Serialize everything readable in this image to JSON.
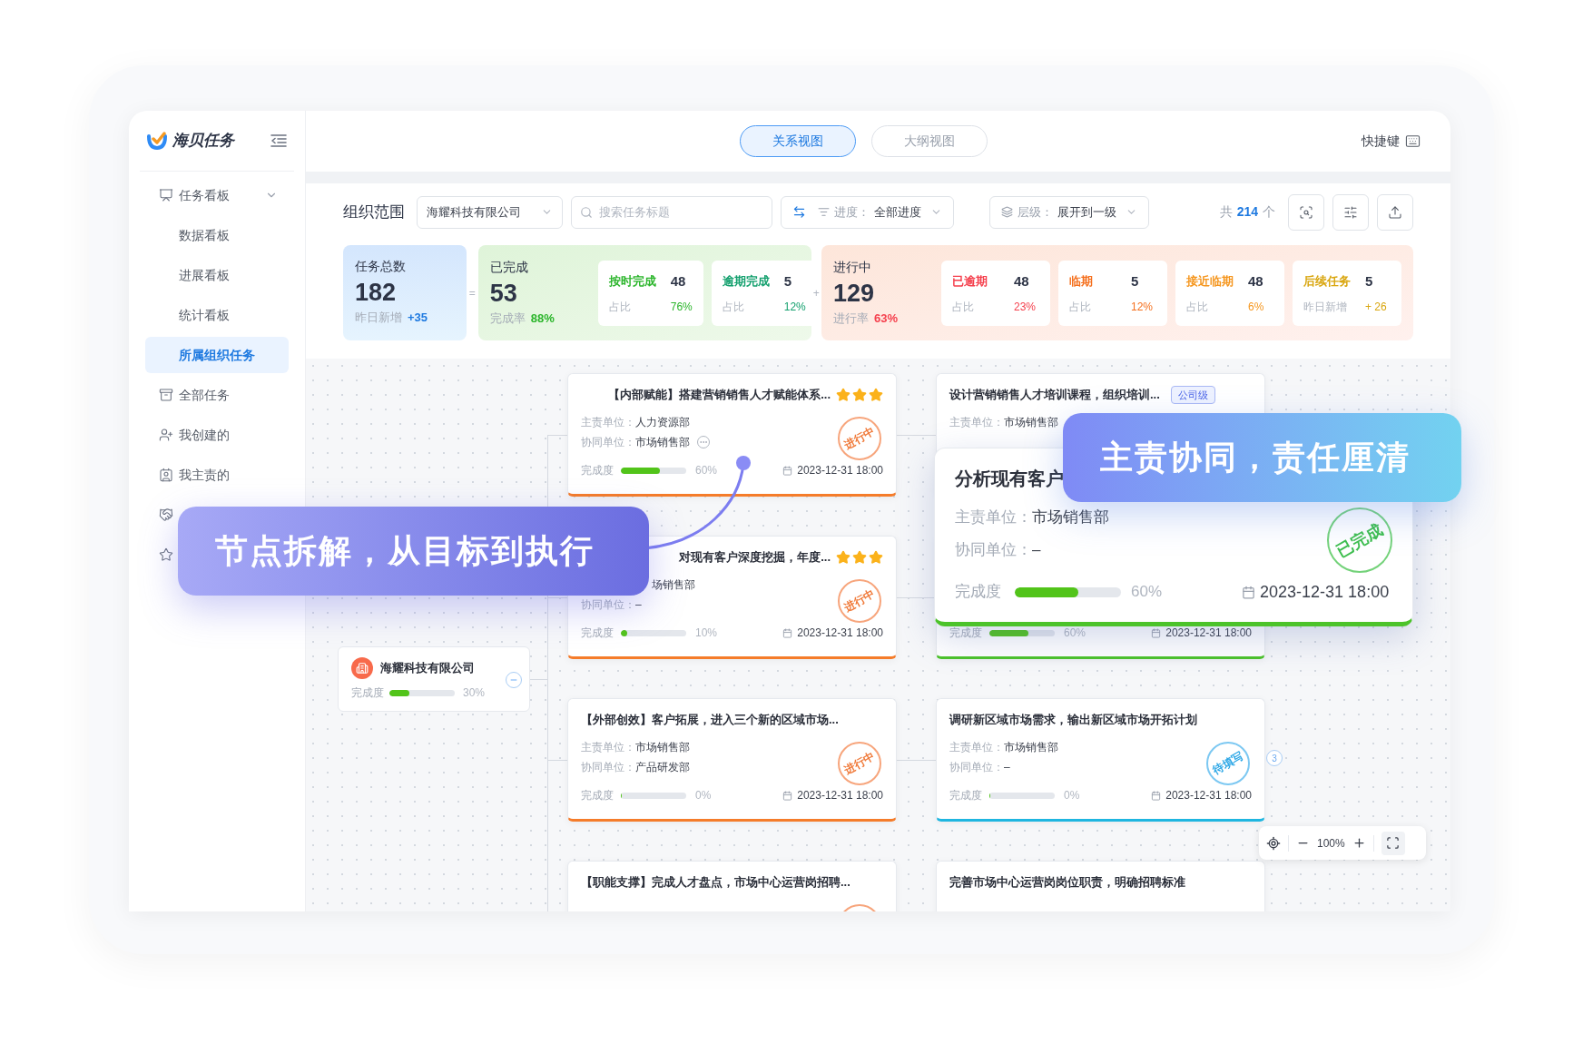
{
  "brand": {
    "name": "海贝任务"
  },
  "sidebar": {
    "items": [
      {
        "label": "任务看板",
        "expanded": true,
        "selected": false,
        "children": [
          {
            "label": "数据看板",
            "selected": false
          },
          {
            "label": "进展看板",
            "selected": false
          },
          {
            "label": "统计看板",
            "selected": false
          },
          {
            "label": "所属组织任务",
            "selected": true
          }
        ]
      },
      {
        "label": "全部任务",
        "selected": false
      },
      {
        "label": "我创建的",
        "selected": false
      },
      {
        "label": "我主责的",
        "selected": false
      },
      {
        "selected": false
      },
      {
        "selected": false
      }
    ]
  },
  "header": {
    "tabs": [
      {
        "label": "关系视图",
        "selected": true
      },
      {
        "label": "大纲视图",
        "selected": false
      }
    ],
    "shortcut": "快捷键"
  },
  "toolbar": {
    "scope_label": "组织范围",
    "org_select": "海耀科技有限公司",
    "search": {
      "placeholder": "搜索任务标题"
    },
    "progress_filter": {
      "label": "进度：",
      "value": "全部进度"
    },
    "level_filter": {
      "label": "层级：",
      "value": "展开到一级"
    },
    "total": {
      "prefix": "共",
      "count": "214",
      "suffix": "个"
    }
  },
  "stats": {
    "total": {
      "label": "任务总数",
      "value": "182",
      "sub_label": "昨日新增",
      "sub_value": "+35"
    },
    "equals": "=",
    "done": {
      "label": "已完成",
      "value": "53",
      "rate_label": "完成率",
      "rate": "88%",
      "items": [
        {
          "label": "按时完成",
          "value": "48",
          "sub_label": "占比",
          "sub_value": "76%",
          "color": "#2bb52b"
        },
        {
          "label": "逾期完成",
          "value": "5",
          "sub_label": "占比",
          "sub_value": "12%",
          "color": "#14a06e"
        }
      ]
    },
    "plus": "+",
    "ongoing": {
      "label": "进行中",
      "value": "129",
      "rate_label": "进行率",
      "rate": "63%",
      "items": [
        {
          "label": "已逾期",
          "value": "48",
          "sub_label": "占比",
          "sub_value": "23%",
          "color": "#f5414e"
        },
        {
          "label": "临期",
          "value": "5",
          "sub_label": "占比",
          "sub_value": "12%",
          "color": "#f5701e"
        },
        {
          "label": "接近临期",
          "value": "48",
          "sub_label": "占比",
          "sub_value": "6%",
          "color": "#f5961e"
        },
        {
          "label": "后续任务",
          "value": "5",
          "sub_label": "昨日新增",
          "sub_value": "+ 26",
          "color": "#d9a60f"
        }
      ]
    }
  },
  "canvas": {
    "root": {
      "name": "海耀科技有限公司",
      "progress_label": "完成度",
      "level": 0.3,
      "percent": "30%",
      "expanded": true
    },
    "columns": [
      [
        {
          "title": "【内部赋能】搭建营销销售人才赋能体系...",
          "stars": 3,
          "more": true,
          "lead_label": "主责单位：",
          "lead": "人力资源部",
          "co_label": "协同单位：",
          "co": "市场销售部",
          "progress_label": "完成度",
          "level": 0.6,
          "percent": "60%",
          "date": "2023-12-31 18:00",
          "kind": "ongoing",
          "stamp": "进行中"
        },
        {
          "title": "对现有客户深度挖掘，年度...",
          "stars": 3,
          "lead": "场销售部",
          "co_label": "协同单位：",
          "co": "–",
          "progress_label": "完成度",
          "level": 0.1,
          "percent": "10%",
          "date": "2023-12-31 18:00",
          "kind": "ongoing",
          "stamp": "进行中"
        },
        {
          "title": "【外部创效】客户拓展，进入三个新的区域市场...",
          "lead_label": "主责单位：",
          "lead": "市场销售部",
          "co_label": "协同单位：",
          "co": "产品研发部",
          "progress_label": "完成度",
          "level": 0,
          "percent": "0%",
          "date": "2023-12-31 18:00",
          "kind": "ongoing",
          "stamp": "进行中"
        },
        {
          "title": "【职能支撑】完成人才盘点，市场中心运营岗招聘...",
          "kind": "ongoing"
        }
      ],
      [
        {
          "title": "设计营销销售人才培训课程，组织培训...",
          "tag": "公司级",
          "lead_label": "主责单位：",
          "lead": "市场销售部"
        },
        {
          "progress_label": "完成度",
          "level": 0.6,
          "percent": "60%",
          "date": "2023-12-31 18:00",
          "kind": "done"
        },
        {
          "title": "调研新区域市场需求，输出新区域市场开拓计划",
          "lead_label": "主责单位：",
          "lead": "市场销售部",
          "co_label": "协同单位：",
          "co": "–",
          "progress_label": "完成度",
          "level": 0,
          "percent": "0%",
          "date": "2023-12-31 18:00",
          "kind": "pending",
          "stamp": "待填写",
          "badge": "3"
        },
        {
          "title": "完善市场中心运营岗岗位职责，明确招聘标准"
        }
      ]
    ],
    "zoom": {
      "value": "100%"
    }
  },
  "highlight_card": {
    "title": "分析现有客户",
    "lead_label": "主责单位：",
    "lead": "市场销售部",
    "co_label": "协同单位：",
    "co": "–",
    "progress_label": "完成度",
    "level": 0.6,
    "percent": "60%",
    "date": "2023-12-31 18:00",
    "kind": "done",
    "stamp": "已完成"
  },
  "callouts": [
    {
      "text": "节点拆解，从目标到执行"
    },
    {
      "text": "主责协同，责任厘清"
    }
  ]
}
